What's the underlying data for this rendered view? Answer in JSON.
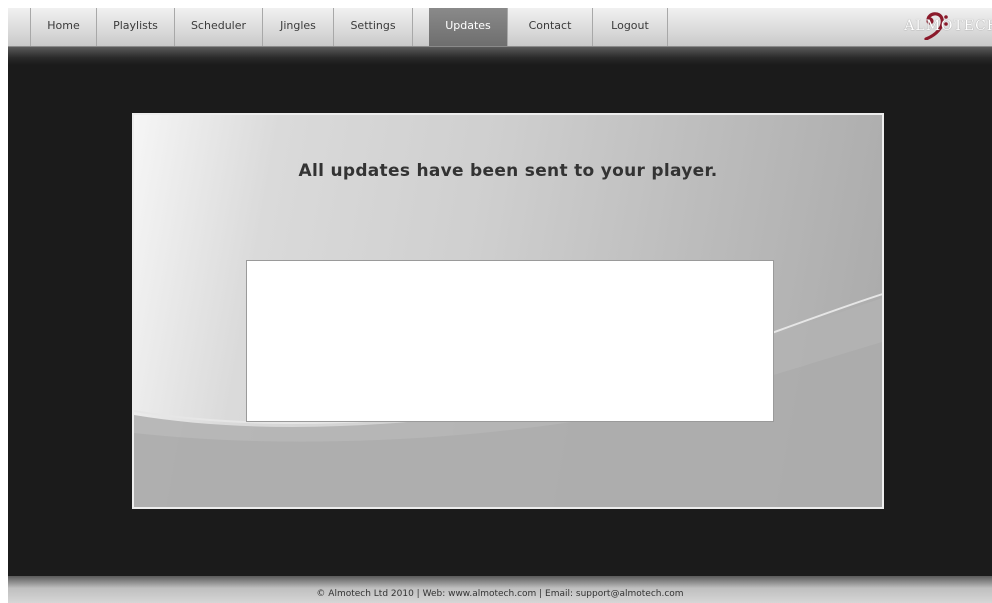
{
  "nav": {
    "items": [
      {
        "label": "Home",
        "active": false
      },
      {
        "label": "Playlists",
        "active": false
      },
      {
        "label": "Scheduler",
        "active": false
      },
      {
        "label": "Jingles",
        "active": false
      },
      {
        "label": "Settings",
        "active": false
      },
      {
        "label": "Updates",
        "active": true
      },
      {
        "label": "Contact",
        "active": false
      },
      {
        "label": "Logout",
        "active": false
      }
    ],
    "active_color": "#777777"
  },
  "logo": {
    "text": "ALMOTECH",
    "icon": "bass-clef-icon",
    "color": "#8b1a2b"
  },
  "main": {
    "message": "All updates have been sent to your player.",
    "updates_box_content": ""
  },
  "footer": {
    "text": "© Almotech Ltd 2010 | Web: www.almotech.com | Email: support@almotech.com"
  }
}
